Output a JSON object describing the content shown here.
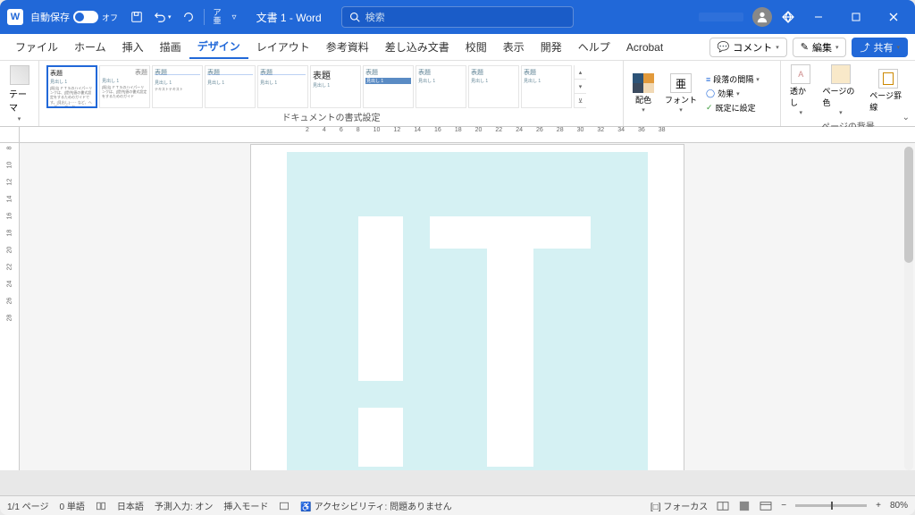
{
  "titlebar": {
    "autosave_label": "自動保存",
    "autosave_state": "オフ",
    "doc_title": "文書 1 - Word",
    "search_placeholder": "検索"
  },
  "menu": {
    "items": [
      "ファイル",
      "ホーム",
      "挿入",
      "描画",
      "デザイン",
      "レイアウト",
      "参考資料",
      "差し込み文書",
      "校閲",
      "表示",
      "開発",
      "ヘルプ",
      "Acrobat"
    ],
    "active_index": 4,
    "comment": "コメント",
    "edit": "編集",
    "share": "共有"
  },
  "ribbon": {
    "theme_label": "テーマ",
    "gallery_label": "ドキュメントの書式設定",
    "gallery_items": [
      {
        "title": "表題",
        "sub": "見出し 1"
      },
      {
        "title": "表題",
        "sub": "見出し 1"
      },
      {
        "title": "表題",
        "sub": "見出し 1"
      },
      {
        "title": "表題",
        "sub": "見出し 1"
      },
      {
        "title": "表題",
        "sub": "見出し 1"
      },
      {
        "title": "表題",
        "sub": "見出し 1"
      },
      {
        "title": "表題",
        "sub": "見出し 1"
      },
      {
        "title": "表題",
        "sub": "見出し 1"
      },
      {
        "title": "表題",
        "sub": "見出し 1"
      },
      {
        "title": "表題",
        "sub": "見出し 1"
      }
    ],
    "colors_label": "配色",
    "fonts_label": "フォント",
    "para_spacing": "段落の間隔",
    "effects": "効果",
    "set_default": "既定に設定",
    "watermark": "透かし",
    "page_color": "ページの色",
    "page_border": "ページ罫線",
    "page_bg_label": "ページの背景"
  },
  "ruler": {
    "marks": [
      "2",
      "4",
      "6",
      "8",
      "10",
      "12",
      "14",
      "16",
      "18",
      "20",
      "22",
      "24",
      "26",
      "28",
      "30",
      "32",
      "34",
      "36",
      "38"
    ]
  },
  "vruler_marks": [
    "8",
    "10",
    "12",
    "14",
    "16",
    "18",
    "20",
    "22",
    "24",
    "26",
    "28"
  ],
  "status": {
    "page": "1/1 ページ",
    "words": "0 単語",
    "lang": "日本語",
    "predict": "予測入力: オン",
    "insert_mode": "挿入モード",
    "accessibility": "アクセシビリティ: 問題ありません",
    "focus": "フォーカス",
    "zoom": "80%"
  }
}
